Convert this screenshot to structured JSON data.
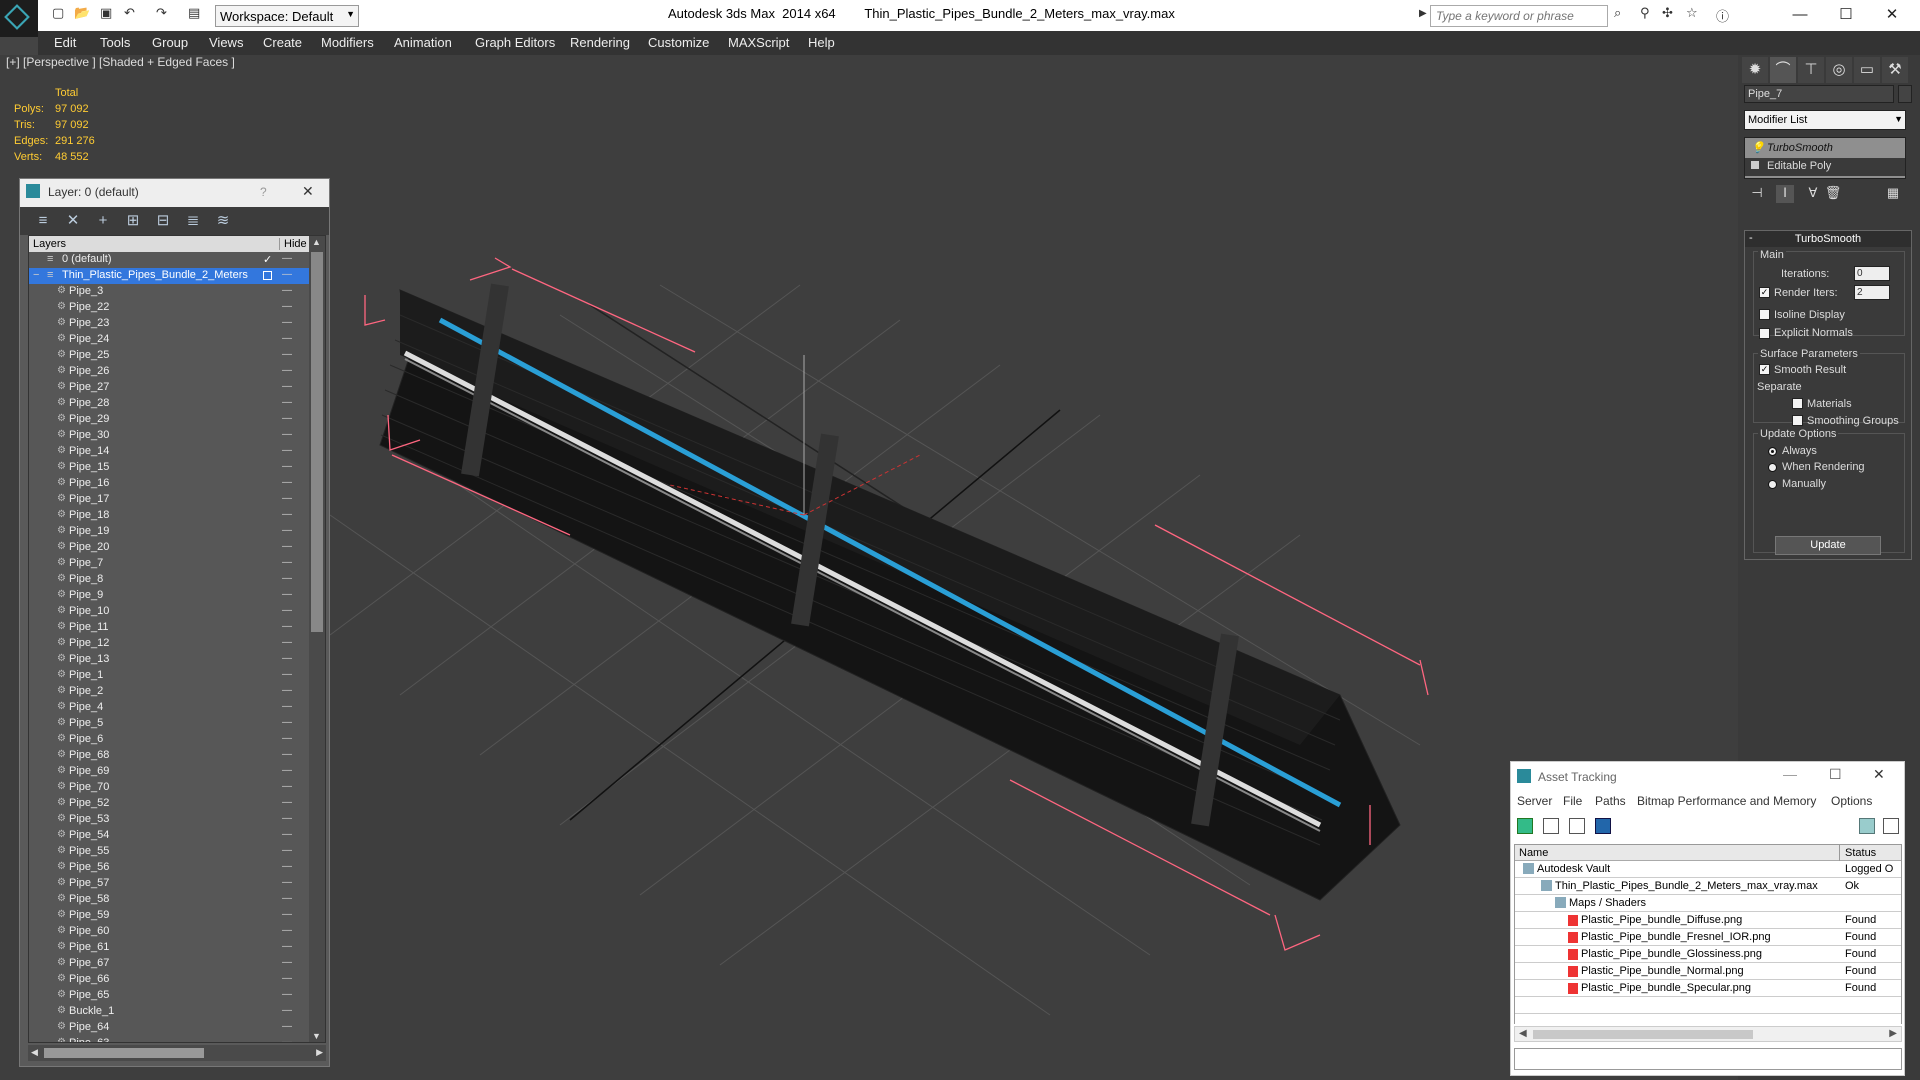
{
  "titlebar": {
    "app": "Autodesk 3ds Max  2014 x64",
    "file": "Thin_Plastic_Pipes_Bundle_2_Meters_max_vray.max",
    "workspace": "Workspace: Default",
    "search_placeholder": "Type a keyword or phrase"
  },
  "menu": [
    "Edit",
    "Tools",
    "Group",
    "Views",
    "Create",
    "Modifiers",
    "Animation",
    "Graph Editors",
    "Rendering",
    "Customize",
    "MAXScript",
    "Help"
  ],
  "viewport": {
    "label": "[+] [Perspective ] [Shaded + Edged Faces ]",
    "stats": {
      "header": "Total",
      "rows": [
        {
          "k": "Polys:",
          "v": "97 092"
        },
        {
          "k": "Tris:",
          "v": "97 092"
        },
        {
          "k": "Edges:",
          "v": "291 276"
        },
        {
          "k": "Verts:",
          "v": "48 552"
        }
      ]
    }
  },
  "layer_window": {
    "title": "Layer: 0 (default)",
    "help": "?",
    "close": "✕",
    "col_layers": "Layers",
    "col_hide": "Hide",
    "default_layer": "0 (default)",
    "selected_layer": "Thin_Plastic_Pipes_Bundle_2_Meters",
    "objects": [
      "Pipe_3",
      "Pipe_22",
      "Pipe_23",
      "Pipe_24",
      "Pipe_25",
      "Pipe_26",
      "Pipe_27",
      "Pipe_28",
      "Pipe_29",
      "Pipe_30",
      "Pipe_14",
      "Pipe_15",
      "Pipe_16",
      "Pipe_17",
      "Pipe_18",
      "Pipe_19",
      "Pipe_20",
      "Pipe_7",
      "Pipe_8",
      "Pipe_9",
      "Pipe_10",
      "Pipe_11",
      "Pipe_12",
      "Pipe_13",
      "Pipe_1",
      "Pipe_2",
      "Pipe_4",
      "Pipe_5",
      "Pipe_6",
      "Pipe_68",
      "Pipe_69",
      "Pipe_70",
      "Pipe_52",
      "Pipe_53",
      "Pipe_54",
      "Pipe_55",
      "Pipe_56",
      "Pipe_57",
      "Pipe_58",
      "Pipe_59",
      "Pipe_60",
      "Pipe_61",
      "Pipe_67",
      "Pipe_66",
      "Pipe_65",
      "Buckle_1",
      "Pipe_64",
      "Pipe_63"
    ]
  },
  "command_panel": {
    "object_name": "Pipe_7",
    "modifier_list": "Modifier List",
    "stack": [
      "TurboSmooth",
      "Editable Poly"
    ],
    "rollout": "TurboSmooth",
    "main": "Main",
    "iterations_label": "Iterations:",
    "iterations": "0",
    "render_iters_label": "Render Iters:",
    "render_iters": "2",
    "isoline": "Isoline Display",
    "explicit_normals": "Explicit Normals",
    "surface_params": "Surface Parameters",
    "smooth_result": "Smooth Result",
    "separate": "Separate",
    "materials": "Materials",
    "smoothing_groups": "Smoothing Groups",
    "update_options": "Update Options",
    "always": "Always",
    "when_rendering": "When Rendering",
    "manually": "Manually",
    "update": "Update"
  },
  "asset_tracking": {
    "title": "Asset Tracking",
    "menu": [
      "Server",
      "File",
      "Paths",
      "Bitmap Performance and Memory",
      "Options"
    ],
    "col_name": "Name",
    "col_status": "Status",
    "rows": [
      {
        "name": "Autodesk Vault",
        "status": "Logged O"
      },
      {
        "name": "Thin_Plastic_Pipes_Bundle_2_Meters_max_vray.max",
        "status": "Ok"
      },
      {
        "name": "Maps / Shaders",
        "status": ""
      },
      {
        "name": "Plastic_Pipe_bundle_Diffuse.png",
        "status": "Found"
      },
      {
        "name": "Plastic_Pipe_bundle_Fresnel_IOR.png",
        "status": "Found"
      },
      {
        "name": "Plastic_Pipe_bundle_Glossiness.png",
        "status": "Found"
      },
      {
        "name": "Plastic_Pipe_bundle_Normal.png",
        "status": "Found"
      },
      {
        "name": "Plastic_Pipe_bundle_Specular.png",
        "status": "Found"
      }
    ]
  },
  "colors": {
    "accent": "#3399ff",
    "stats": "#ffcc33",
    "selection": "#3377dd"
  }
}
